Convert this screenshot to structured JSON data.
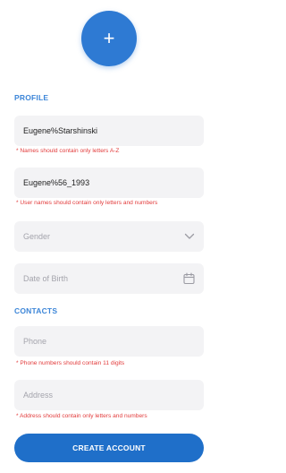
{
  "avatar": {
    "add_symbol": "+"
  },
  "profile": {
    "section_label": "PROFILE",
    "name": {
      "value": "Eugene%Starshinski",
      "error": "* Names should contain only letters A-Z"
    },
    "username": {
      "value": "Eugene%56_1993",
      "error": "* User names should contain only letters and numbers"
    },
    "gender": {
      "placeholder": "Gender",
      "icon": "chevron-down-icon"
    },
    "birth": {
      "placeholder": "Date of Birth",
      "icon": "calendar-icon"
    }
  },
  "contacts": {
    "section_label": "CONTACTS",
    "phone": {
      "placeholder": "Phone",
      "error": "* Phone numbers should contain 11 digits"
    },
    "address": {
      "placeholder": "Address",
      "error": "* Address should contain only letters and numbers"
    }
  },
  "create_button_label": "CREATE ACCOUNT",
  "colors": {
    "accent": "#2e7ad3",
    "error": "#e23b3b",
    "field_bg": "#f3f3f5"
  }
}
